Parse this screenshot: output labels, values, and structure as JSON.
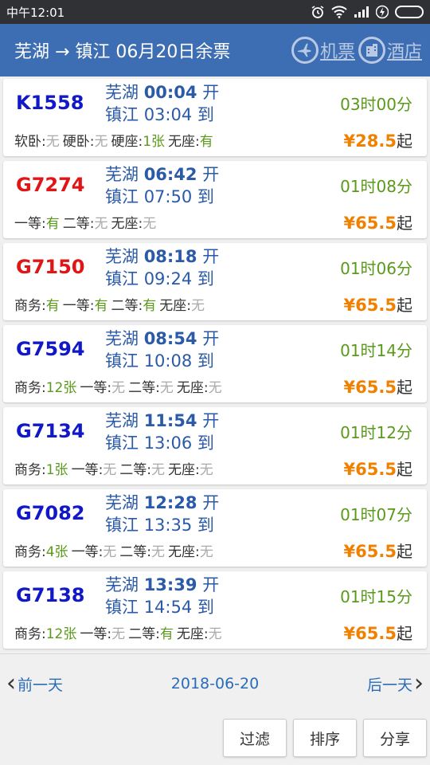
{
  "status_bar": {
    "time": "中午12:01"
  },
  "header": {
    "title": "芜湖 → 镇江 06月20日余票",
    "flight_label": "机票",
    "hotel_label": "酒店"
  },
  "trains": [
    {
      "number": "K1558",
      "color": "blue",
      "dep_station": "芜湖",
      "dep_time": "00:04",
      "dep_suffix": "开",
      "arr_station": "镇江",
      "arr_time": "03:04",
      "arr_suffix": "到",
      "duration": "03时00分",
      "price_symbol": "¥",
      "price": "28.5",
      "price_suffix": "起",
      "seats": [
        {
          "name": "软卧",
          "value": "无",
          "status": "none"
        },
        {
          "name": "硬卧",
          "value": "无",
          "status": "none"
        },
        {
          "name": "硬座",
          "value": "1张",
          "status": "yes"
        },
        {
          "name": "无座",
          "value": "有",
          "status": "yes"
        }
      ]
    },
    {
      "number": "G7274",
      "color": "red",
      "dep_station": "芜湖",
      "dep_time": "06:42",
      "dep_suffix": "开",
      "arr_station": "镇江",
      "arr_time": "07:50",
      "arr_suffix": "到",
      "duration": "01时08分",
      "price_symbol": "¥",
      "price": "65.5",
      "price_suffix": "起",
      "seats": [
        {
          "name": "一等",
          "value": "有",
          "status": "yes"
        },
        {
          "name": "二等",
          "value": "无",
          "status": "none"
        },
        {
          "name": "无座",
          "value": "无",
          "status": "none"
        }
      ]
    },
    {
      "number": "G7150",
      "color": "red",
      "dep_station": "芜湖",
      "dep_time": "08:18",
      "dep_suffix": "开",
      "arr_station": "镇江",
      "arr_time": "09:24",
      "arr_suffix": "到",
      "duration": "01时06分",
      "price_symbol": "¥",
      "price": "65.5",
      "price_suffix": "起",
      "seats": [
        {
          "name": "商务",
          "value": "有",
          "status": "yes"
        },
        {
          "name": "一等",
          "value": "有",
          "status": "yes"
        },
        {
          "name": "二等",
          "value": "有",
          "status": "yes"
        },
        {
          "name": "无座",
          "value": "无",
          "status": "none"
        }
      ]
    },
    {
      "number": "G7594",
      "color": "blue",
      "dep_station": "芜湖",
      "dep_time": "08:54",
      "dep_suffix": "开",
      "arr_station": "镇江",
      "arr_time": "10:08",
      "arr_suffix": "到",
      "duration": "01时14分",
      "price_symbol": "¥",
      "price": "65.5",
      "price_suffix": "起",
      "seats": [
        {
          "name": "商务",
          "value": "12张",
          "status": "yes"
        },
        {
          "name": "一等",
          "value": "无",
          "status": "none"
        },
        {
          "name": "二等",
          "value": "无",
          "status": "none"
        },
        {
          "name": "无座",
          "value": "无",
          "status": "none"
        }
      ]
    },
    {
      "number": "G7134",
      "color": "blue",
      "dep_station": "芜湖",
      "dep_time": "11:54",
      "dep_suffix": "开",
      "arr_station": "镇江",
      "arr_time": "13:06",
      "arr_suffix": "到",
      "duration": "01时12分",
      "price_symbol": "¥",
      "price": "65.5",
      "price_suffix": "起",
      "seats": [
        {
          "name": "商务",
          "value": "1张",
          "status": "yes"
        },
        {
          "name": "一等",
          "value": "无",
          "status": "none"
        },
        {
          "name": "二等",
          "value": "无",
          "status": "none"
        },
        {
          "name": "无座",
          "value": "无",
          "status": "none"
        }
      ]
    },
    {
      "number": "G7082",
      "color": "blue",
      "dep_station": "芜湖",
      "dep_time": "12:28",
      "dep_suffix": "开",
      "arr_station": "镇江",
      "arr_time": "13:35",
      "arr_suffix": "到",
      "duration": "01时07分",
      "price_symbol": "¥",
      "price": "65.5",
      "price_suffix": "起",
      "seats": [
        {
          "name": "商务",
          "value": "4张",
          "status": "yes"
        },
        {
          "name": "一等",
          "value": "无",
          "status": "none"
        },
        {
          "name": "二等",
          "value": "无",
          "status": "none"
        },
        {
          "name": "无座",
          "value": "无",
          "status": "none"
        }
      ]
    },
    {
      "number": "G7138",
      "color": "blue",
      "dep_station": "芜湖",
      "dep_time": "13:39",
      "dep_suffix": "开",
      "arr_station": "镇江",
      "arr_time": "14:54",
      "arr_suffix": "到",
      "duration": "01时15分",
      "price_symbol": "¥",
      "price": "65.5",
      "price_suffix": "起",
      "seats": [
        {
          "name": "商务",
          "value": "12张",
          "status": "yes"
        },
        {
          "name": "一等",
          "value": "无",
          "status": "none"
        },
        {
          "name": "二等",
          "value": "有",
          "status": "yes"
        },
        {
          "name": "无座",
          "value": "无",
          "status": "none"
        }
      ]
    }
  ],
  "day_nav": {
    "prev_label": "前一天",
    "date": "2018-06-20",
    "next_label": "后一天"
  },
  "actions": {
    "filter_label": "过滤",
    "sort_label": "排序",
    "share_label": "分享"
  },
  "colors": {
    "header_bg": "#3d6db3",
    "train_blue": "#1018c8",
    "train_red": "#e01515",
    "time_blue": "#2a5aa8",
    "available_green": "#5a9a1a",
    "unavailable_gray": "#aaaaaa",
    "price_orange": "#f08000"
  }
}
